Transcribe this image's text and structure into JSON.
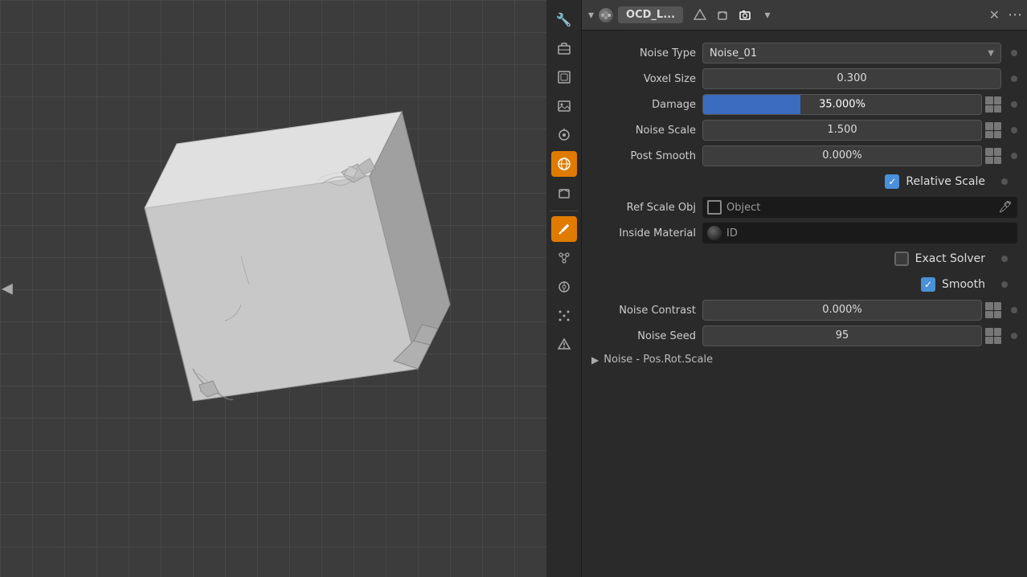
{
  "viewport": {
    "background_color": "#3c3c3c"
  },
  "header": {
    "arrow_label": "◀",
    "title": "OCD_L...",
    "close_label": "✕",
    "more_label": "⋯",
    "expand_label": "▾"
  },
  "toolbar": {
    "items": [
      {
        "name": "wrench",
        "label": "🔧",
        "active": false
      },
      {
        "name": "briefcase",
        "label": "🧰",
        "active": false
      },
      {
        "name": "frame",
        "label": "⬜",
        "active": false
      },
      {
        "name": "image",
        "label": "🖼",
        "active": false
      },
      {
        "name": "paint",
        "label": "🎨",
        "active": false
      },
      {
        "name": "globe",
        "label": "🌐",
        "active": true
      },
      {
        "name": "box",
        "label": "⬛",
        "active": false
      },
      {
        "name": "tool",
        "label": "🔧",
        "active": true
      },
      {
        "name": "nodes",
        "label": "✦",
        "active": false
      },
      {
        "name": "constraint",
        "label": "⚙",
        "active": false
      },
      {
        "name": "particles",
        "label": "✸",
        "active": false
      },
      {
        "name": "physics",
        "label": "◈",
        "active": false
      }
    ]
  },
  "properties": {
    "noise_type": {
      "label": "Noise Type",
      "value": "Noise_01"
    },
    "voxel_size": {
      "label": "Voxel Size",
      "value": "0.300"
    },
    "damage": {
      "label": "Damage",
      "value": "35.000%",
      "fill_percent": 35
    },
    "noise_scale": {
      "label": "Noise Scale",
      "value": "1.500"
    },
    "post_smooth": {
      "label": "Post Smooth",
      "value": "0.000%"
    },
    "relative_scale": {
      "label": "Relative Scale",
      "checked": true
    },
    "ref_scale_obj": {
      "label": "Ref Scale Obj",
      "value": "Object",
      "placeholder": "Object"
    },
    "inside_material": {
      "label": "Inside Material",
      "value": "ID"
    },
    "exact_solver": {
      "label": "Exact Solver",
      "checked": false
    },
    "smooth": {
      "label": "Smooth",
      "checked": true
    },
    "noise_contrast": {
      "label": "Noise Contrast",
      "value": "0.000%"
    },
    "noise_seed": {
      "label": "Noise Seed",
      "value": "95"
    },
    "noise_pos_section": {
      "label": "Noise - Pos.Rot.Scale"
    }
  },
  "icons": {
    "check": "✓",
    "dropdown_arrow": "▼",
    "left_arrow": "◀",
    "right_arrow": "▶",
    "section_arrow": "▶",
    "eyedropper": "💉",
    "close": "✕",
    "more": "···"
  }
}
